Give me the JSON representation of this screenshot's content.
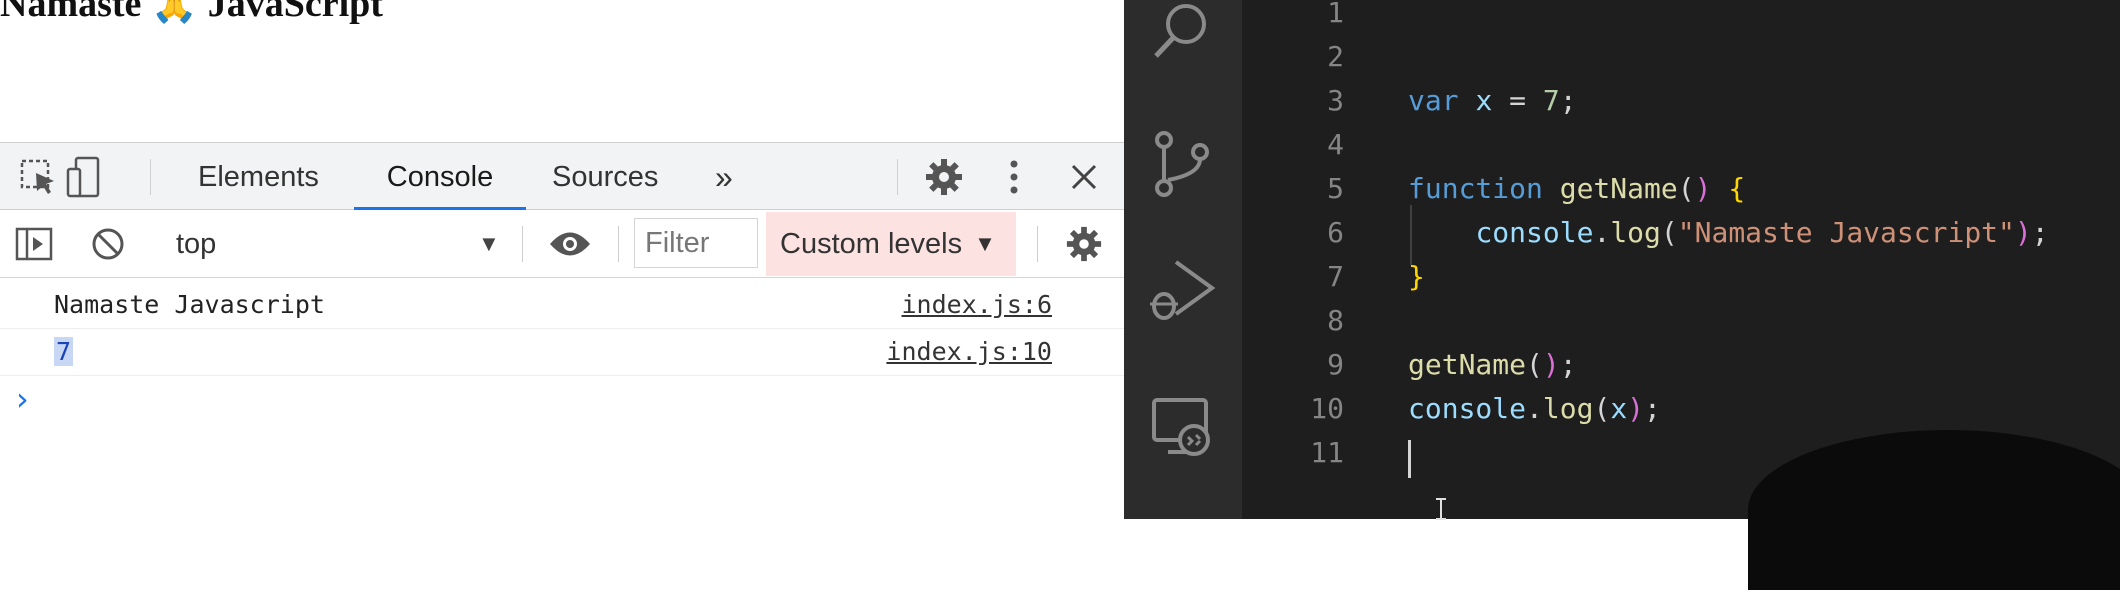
{
  "page": {
    "title": "Namaste 🙏 JavaScript"
  },
  "devtools": {
    "tabs": [
      {
        "label": "Elements",
        "active": false
      },
      {
        "label": "Console",
        "active": true
      },
      {
        "label": "Sources",
        "active": false
      }
    ],
    "more_tabs": "»",
    "icons": [
      "inspect-icon",
      "device-toolbar-icon",
      "settings-gear-icon",
      "kebab-menu-icon",
      "close-icon"
    ],
    "accent": "#1a73e8"
  },
  "console_toolbar": {
    "context": "top",
    "filter_placeholder": "Filter",
    "levels": "Custom levels",
    "levels_bg": "#fde2e2"
  },
  "console": {
    "rows": [
      {
        "message": "Namaste Javascript",
        "source": "index.js:6"
      },
      {
        "message": "7",
        "source": "index.js:10",
        "highlighted": true
      }
    ],
    "prompt": "›"
  },
  "editor": {
    "line_numbers": [
      "1",
      "2",
      "3",
      "4",
      "5",
      "6",
      "7",
      "8",
      "9",
      "10",
      "11"
    ],
    "lines": [
      "",
      "",
      "var x = 7;",
      "",
      "function getName() {",
      "    console.log(\"Namaste Javascript\");",
      "}",
      "",
      "getName();",
      "console.log(x);",
      ""
    ],
    "activity_icons": [
      "search-icon",
      "source-control-icon",
      "run-debug-icon",
      "remote-explorer-icon"
    ]
  }
}
